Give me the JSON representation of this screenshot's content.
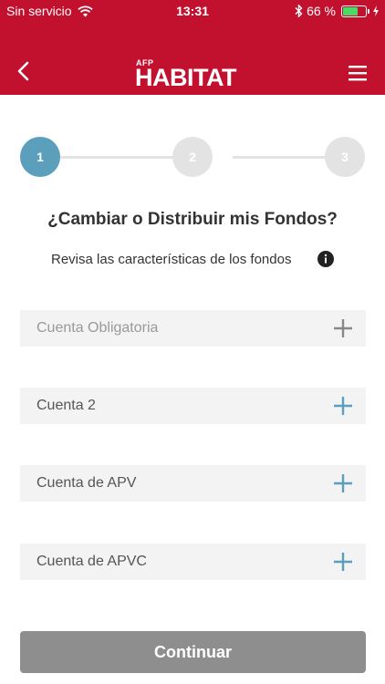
{
  "status_bar": {
    "carrier": "Sin servicio",
    "time": "13:31",
    "battery_pct": "66 %",
    "battery_level": 0.66
  },
  "header": {
    "logo_small": "AFP",
    "logo_main": "HABITAT",
    "color": "#c1112f"
  },
  "stepper": {
    "steps": [
      "1",
      "2",
      "3"
    ],
    "active": 1,
    "active_color": "#5b9fbc"
  },
  "content": {
    "title": "¿Cambiar o Distribuir mis Fondos?",
    "subtitle": "Revisa las características de los fondos"
  },
  "accounts": [
    {
      "label": "Cuenta Obligatoria",
      "enabled": false
    },
    {
      "label": "Cuenta 2",
      "enabled": true
    },
    {
      "label": "Cuenta de APV",
      "enabled": true
    },
    {
      "label": "Cuenta de APVC",
      "enabled": true
    }
  ],
  "footer": {
    "continue_label": "Continuar"
  },
  "icons": {
    "back": "chevron-left-icon",
    "menu": "hamburger-icon",
    "info": "info-icon",
    "expand": "plus-icon"
  }
}
